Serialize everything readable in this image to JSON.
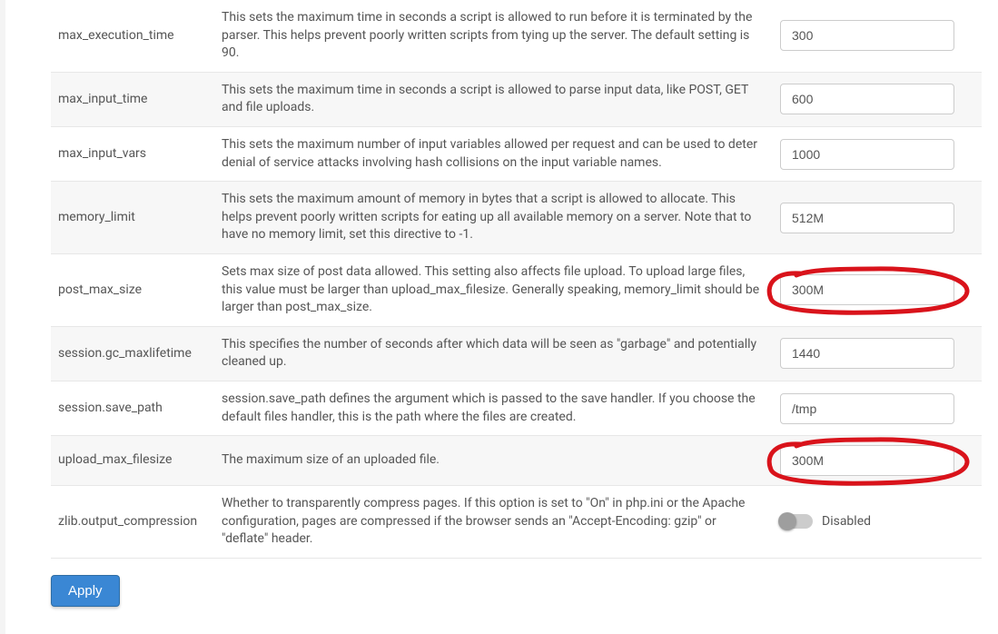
{
  "settings": [
    {
      "name": "max_execution_time",
      "description": "This sets the maximum time in seconds a script is allowed to run before it is terminated by the parser. This helps prevent poorly written scripts from tying up the server. The default setting is 90.",
      "value": "300",
      "type": "text",
      "highlight": false
    },
    {
      "name": "max_input_time",
      "description": "This sets the maximum time in seconds a script is allowed to parse input data, like POST, GET and file uploads.",
      "value": "600",
      "type": "text",
      "highlight": false
    },
    {
      "name": "max_input_vars",
      "description": "This sets the maximum number of input variables allowed per request and can be used to deter denial of service attacks involving hash collisions on the input variable names.",
      "value": "1000",
      "type": "text",
      "highlight": false
    },
    {
      "name": "memory_limit",
      "description": "This sets the maximum amount of memory in bytes that a script is allowed to allocate. This helps prevent poorly written scripts for eating up all available memory on a server. Note that to have no memory limit, set this directive to -1.",
      "value": "512M",
      "type": "text",
      "highlight": false
    },
    {
      "name": "post_max_size",
      "description": "Sets max size of post data allowed. This setting also affects file upload. To upload large files, this value must be larger than upload_max_filesize. Generally speaking, memory_limit should be larger than post_max_size.",
      "value": "300M",
      "type": "text",
      "highlight": true
    },
    {
      "name": "session.gc_maxlifetime",
      "description": "This specifies the number of seconds after which data will be seen as \"garbage\" and potentially cleaned up.",
      "value": "1440",
      "type": "text",
      "highlight": false
    },
    {
      "name": "session.save_path",
      "description": "session.save_path defines the argument which is passed to the save handler. If you choose the default files handler, this is the path where the files are created.",
      "value": "/tmp",
      "type": "text",
      "highlight": false
    },
    {
      "name": "upload_max_filesize",
      "description": "The maximum size of an uploaded file.",
      "value": "300M",
      "type": "text",
      "highlight": true
    },
    {
      "name": "zlib.output_compression",
      "description": "Whether to transparently compress pages. If this option is set to \"On\" in php.ini or the Apache configuration, pages are compressed if the browser sends an \"Accept-Encoding: gzip\" or \"deflate\" header.",
      "value": "Disabled",
      "type": "toggle",
      "highlight": false
    }
  ],
  "buttons": {
    "apply": "Apply"
  }
}
